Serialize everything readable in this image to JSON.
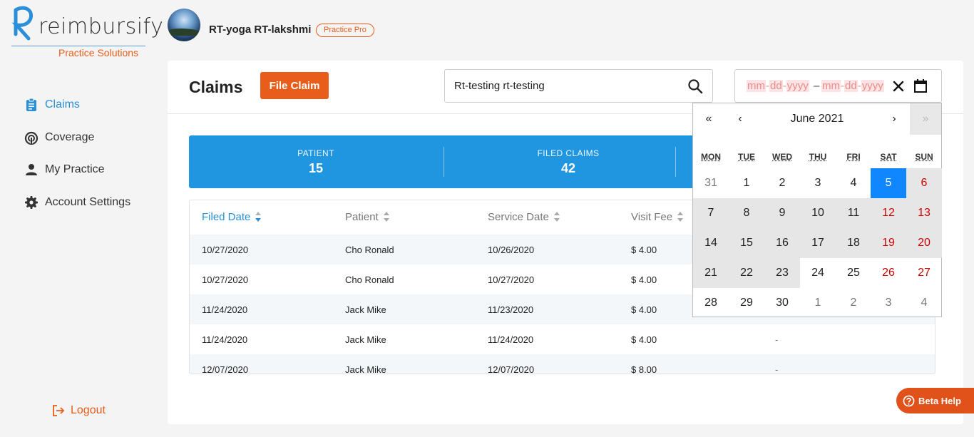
{
  "brand": {
    "name": "reimbursify",
    "subtitle": "Practice Solutions"
  },
  "header": {
    "user_name": "RT-yoga RT-lakshmi",
    "plan_badge": "Practice Pro"
  },
  "sidebar": {
    "items": [
      {
        "label": "Claims",
        "icon": "clipboard-icon",
        "active": true
      },
      {
        "label": "Coverage",
        "icon": "coverage-icon",
        "active": false
      },
      {
        "label": "My Practice",
        "icon": "person-icon",
        "active": false
      },
      {
        "label": "Account Settings",
        "icon": "gear-icon",
        "active": false
      }
    ],
    "logout_label": "Logout"
  },
  "main": {
    "title": "Claims",
    "file_claim_label": "File Claim",
    "search": {
      "value": "Rt-testing rt-testing",
      "placeholder": ""
    },
    "date_range": {
      "start_month": "mm",
      "start_day": "dd",
      "start_year": "yyyy",
      "end_month": "mm",
      "end_day": "dd",
      "end_year": "yyyy",
      "separator": "–"
    },
    "stats": [
      {
        "label": "PATIENT",
        "value": "15"
      },
      {
        "label": "FILED CLAIMS",
        "value": "42"
      }
    ],
    "table": {
      "columns": [
        "Filed Date",
        "Patient",
        "Service Date",
        "Visit Fee"
      ],
      "sorted_column": "Filed Date",
      "rows": [
        {
          "filed": "10/27/2020",
          "patient": "Cho Ronald",
          "service": "10/26/2020",
          "fee": "$ 4.00",
          "extra": ""
        },
        {
          "filed": "10/27/2020",
          "patient": "Cho Ronald",
          "service": "10/27/2020",
          "fee": "$ 4.00",
          "extra": ""
        },
        {
          "filed": "11/24/2020",
          "patient": "Jack Mike",
          "service": "11/23/2020",
          "fee": "$ 4.00",
          "extra": ""
        },
        {
          "filed": "11/24/2020",
          "patient": "Jack Mike",
          "service": "11/24/2020",
          "fee": "$ 4.00",
          "extra": "-"
        },
        {
          "filed": "12/07/2020",
          "patient": "Jack Mike",
          "service": "12/07/2020",
          "fee": "$ 8.00",
          "extra": "-"
        }
      ]
    }
  },
  "calendar": {
    "month_label": "June 2021",
    "nav": {
      "prev_year": "«",
      "prev_month": "‹",
      "next_month": "›",
      "next_year": "»"
    },
    "weekdays": [
      "MON",
      "TUE",
      "WED",
      "THU",
      "FRI",
      "SAT",
      "SUN"
    ],
    "weeks": [
      [
        "31",
        "1",
        "2",
        "3",
        "4",
        "5",
        "6"
      ],
      [
        "7",
        "8",
        "9",
        "10",
        "11",
        "12",
        "13"
      ],
      [
        "14",
        "15",
        "16",
        "17",
        "18",
        "19",
        "20"
      ],
      [
        "21",
        "22",
        "23",
        "24",
        "25",
        "26",
        "27"
      ],
      [
        "28",
        "29",
        "30",
        "1",
        "2",
        "3",
        "4"
      ]
    ],
    "selected_day": "5",
    "colors": {
      "selected": "#1087ff",
      "weekend": "#d10000",
      "range": "#e6e6e6"
    }
  },
  "beta_help_label": "Beta Help",
  "colors": {
    "accent": "#e85d1a",
    "primary": "#2196e0",
    "link": "#2a8fd8"
  }
}
